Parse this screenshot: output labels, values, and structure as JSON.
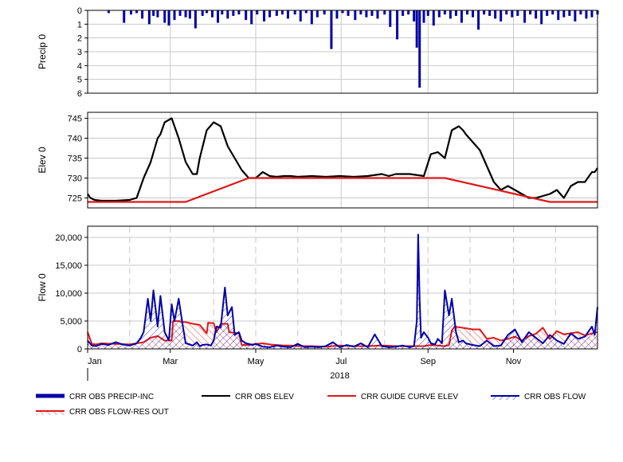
{
  "chart_data": [
    {
      "type": "bar",
      "ylabel": "Precip 0",
      "ylim": [
        0,
        6
      ],
      "y_inverted": true,
      "yticks": [
        "0",
        "1",
        "2",
        "3",
        "4",
        "5",
        "6"
      ],
      "series": [
        {
          "name": "CRR OBS PRECIP-INC",
          "color": "#0000a8",
          "x": [
            15,
            26,
            31,
            35,
            39,
            44,
            47,
            50,
            55,
            58,
            62,
            66,
            70,
            73,
            77,
            82,
            85,
            89,
            93,
            96,
            100,
            104,
            108,
            113,
            117,
            121,
            126,
            130,
            135,
            139,
            143,
            148,
            152,
            156,
            160,
            164,
            169,
            174,
            178,
            182,
            186,
            191,
            195,
            199,
            203,
            207,
            212,
            216,
            221,
            225,
            229,
            233,
            235,
            237,
            240,
            243,
            247,
            251,
            255,
            259,
            263,
            267,
            271,
            275,
            279,
            283,
            287,
            291,
            295,
            299,
            303,
            307,
            312,
            316,
            320,
            324,
            328,
            332,
            336,
            340,
            344,
            348,
            352,
            356,
            360,
            364
          ],
          "values": [
            0.2,
            0.9,
            0.3,
            0.2,
            0.6,
            1.0,
            0.4,
            0.5,
            0.9,
            1.1,
            0.7,
            0.4,
            0.5,
            0.6,
            1.3,
            0.4,
            0.2,
            0.5,
            0.9,
            0.3,
            0.6,
            0.4,
            0.3,
            0.7,
            1.0,
            0.3,
            0.8,
            0.5,
            0.4,
            0.3,
            0.6,
            0.3,
            0.8,
            0.2,
            1.0,
            0.5,
            0.3,
            2.8,
            0.6,
            0.2,
            0.4,
            0.7,
            0.3,
            0.5,
            0.4,
            0.6,
            0.3,
            1.2,
            2.1,
            0.4,
            0.3,
            0.8,
            2.7,
            5.6,
            0.9,
            0.4,
            1.1,
            0.5,
            0.3,
            0.6,
            0.4,
            0.9,
            0.3,
            0.5,
            1.4,
            0.3,
            0.4,
            0.6,
            0.8,
            0.3,
            0.5,
            0.4,
            0.9,
            0.3,
            0.6,
            1.0,
            0.4,
            0.3,
            0.7,
            0.5,
            0.4,
            0.8,
            0.3,
            0.6,
            0.5,
            0.3
          ]
        }
      ]
    },
    {
      "type": "line",
      "ylabel": "Elev 0",
      "ylim": [
        722.5,
        746.5
      ],
      "yticks": [
        "725",
        "730",
        "735",
        "740",
        "745"
      ],
      "series": [
        {
          "name": "CRR OBS ELEV",
          "color": "#000000",
          "x": [
            0,
            2,
            5,
            10,
            20,
            30,
            35,
            40,
            45,
            50,
            52,
            55,
            60,
            65,
            70,
            75,
            78,
            80,
            85,
            90,
            95,
            98,
            100,
            105,
            110,
            115,
            120,
            125,
            130,
            135,
            140,
            145,
            150,
            160,
            170,
            180,
            190,
            200,
            210,
            215,
            220,
            230,
            240,
            245,
            250,
            255,
            260,
            265,
            268,
            270,
            275,
            280,
            285,
            290,
            295,
            300,
            305,
            310,
            315,
            320,
            325,
            330,
            335,
            340,
            345,
            350,
            355,
            360,
            362,
            364
          ],
          "y": [
            726,
            725,
            724.5,
            724.3,
            724.3,
            724.5,
            725,
            730,
            734,
            740,
            741,
            744,
            745,
            740,
            734,
            731,
            731,
            735,
            742,
            744,
            743,
            740,
            738,
            735,
            732,
            730,
            730,
            731.5,
            730.5,
            730.3,
            730.5,
            730.5,
            730.3,
            730.5,
            730.3,
            730.5,
            730.3,
            730.5,
            731,
            730.5,
            731,
            731,
            730.5,
            736,
            736.5,
            735,
            742,
            743,
            742,
            741,
            739,
            737,
            733,
            729,
            727,
            728,
            727,
            726,
            725,
            725,
            725.5,
            726,
            727,
            725,
            728,
            729,
            729,
            731.5,
            731.5,
            732.5
          ]
        },
        {
          "name": "CRR GUIDE CURVE ELEV",
          "color": "#e01818",
          "x": [
            0,
            70,
            115,
            255,
            330,
            364
          ],
          "y": [
            724,
            724,
            730,
            730,
            724,
            724
          ]
        }
      ]
    },
    {
      "type": "area",
      "ylabel": "Flow 0",
      "ylim": [
        0,
        22000
      ],
      "yticks": [
        "0",
        "5,000",
        "10,000",
        "15,000",
        "20,000"
      ],
      "series": [
        {
          "name": "CRR OBS FLOW",
          "color": "#0000a8",
          "x": [
            0,
            3,
            6,
            10,
            15,
            20,
            25,
            30,
            35,
            38,
            40,
            43,
            45,
            47,
            50,
            52,
            55,
            58,
            60,
            62,
            65,
            68,
            70,
            73,
            75,
            78,
            80,
            82,
            85,
            88,
            90,
            92,
            95,
            98,
            100,
            103,
            105,
            108,
            110,
            113,
            115,
            118,
            120,
            125,
            130,
            135,
            140,
            145,
            150,
            155,
            160,
            165,
            170,
            175,
            180,
            185,
            190,
            195,
            200,
            205,
            210,
            215,
            220,
            225,
            230,
            233,
            235,
            236,
            237,
            238,
            240,
            243,
            245,
            248,
            250,
            253,
            255,
            258,
            260,
            263,
            265,
            268,
            270,
            275,
            280,
            285,
            290,
            295,
            300,
            305,
            310,
            315,
            320,
            325,
            330,
            335,
            340,
            345,
            350,
            355,
            360,
            362,
            364
          ],
          "y": [
            1500,
            600,
            500,
            900,
            700,
            1200,
            800,
            600,
            1000,
            2000,
            3000,
            9000,
            5000,
            10500,
            4000,
            9500,
            3000,
            1500,
            8000,
            5000,
            9000,
            4000,
            1000,
            800,
            600,
            1200,
            500,
            700,
            800,
            600,
            1500,
            4000,
            3800,
            11000,
            6000,
            7500,
            2500,
            3000,
            1500,
            1000,
            900,
            700,
            900,
            400,
            300,
            600,
            400,
            300,
            900,
            300,
            400,
            300,
            500,
            1200,
            300,
            700,
            400,
            1000,
            300,
            2600,
            500,
            300,
            400,
            600,
            300,
            500,
            5000,
            20500,
            9000,
            2000,
            3000,
            2000,
            1000,
            800,
            1800,
            1000,
            10500,
            6000,
            9000,
            3000,
            1200,
            1500,
            1000,
            700,
            500,
            1500,
            500,
            600,
            2500,
            3500,
            1200,
            3000,
            2000,
            1000,
            2500,
            1500,
            900,
            2800,
            1800,
            2200,
            4000,
            2500,
            7500
          ]
        },
        {
          "name": "CRR OBS FLOW-RES OUT",
          "color": "#e01818",
          "x": [
            0,
            3,
            6,
            10,
            20,
            30,
            35,
            40,
            45,
            50,
            55,
            60,
            61,
            65,
            67,
            70,
            75,
            80,
            85,
            86,
            90,
            92,
            95,
            100,
            101,
            105,
            108,
            110,
            115,
            120,
            125,
            130,
            135,
            140,
            145,
            150,
            160,
            170,
            180,
            190,
            200,
            210,
            220,
            230,
            240,
            245,
            250,
            255,
            258,
            260,
            262,
            265,
            270,
            275,
            280,
            285,
            290,
            295,
            300,
            305,
            310,
            315,
            320,
            325,
            330,
            335,
            340,
            345,
            350,
            355,
            360,
            364
          ],
          "y": [
            3000,
            900,
            800,
            1000,
            900,
            800,
            1000,
            1200,
            2000,
            2300,
            1500,
            1500,
            5000,
            5000,
            4800,
            4800,
            4500,
            4300,
            2800,
            4700,
            4600,
            3000,
            4500,
            4500,
            3000,
            2900,
            2800,
            700,
            700,
            900,
            1000,
            800,
            700,
            600,
            600,
            500,
            500,
            400,
            600,
            500,
            500,
            600,
            500,
            500,
            500,
            700,
            600,
            500,
            700,
            3300,
            4000,
            3900,
            3700,
            3500,
            3500,
            1800,
            2000,
            1500,
            1800,
            2200,
            1500,
            2300,
            2700,
            3800,
            1800,
            3200,
            2600,
            2800,
            3000,
            2400,
            2800,
            3000
          ]
        }
      ]
    }
  ],
  "xaxis": {
    "ticks": [
      "Jan",
      "Mar",
      "May",
      "Jul",
      "Sep",
      "Nov"
    ],
    "tick_days": [
      0,
      59,
      120,
      181,
      243,
      304
    ],
    "year": "2018"
  },
  "legend": [
    {
      "label": "CRR OBS PRECIP-INC",
      "color": "#0000a8",
      "style": "thick"
    },
    {
      "label": "CRR OBS ELEV",
      "color": "#000000",
      "style": "line"
    },
    {
      "label": "CRR GUIDE CURVE ELEV",
      "color": "#e01818",
      "style": "line"
    },
    {
      "label": "CRR OBS FLOW",
      "color": "#0000a8",
      "style": "hatch"
    },
    {
      "label": "CRR OBS FLOW-RES OUT",
      "color": "#e01818",
      "style": "hatch"
    }
  ]
}
